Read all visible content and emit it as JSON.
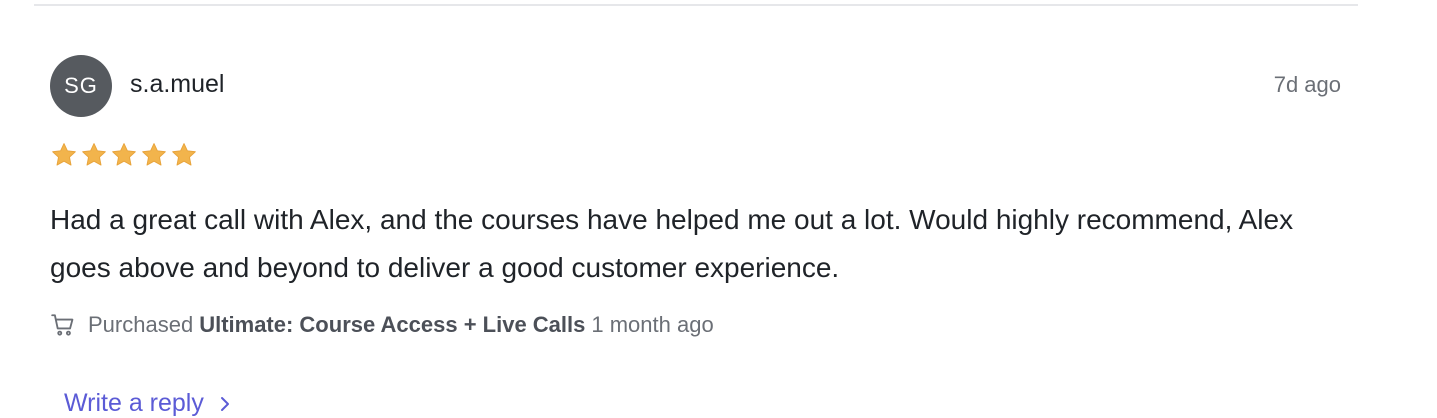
{
  "review": {
    "avatar_initials": "SG",
    "username": "s.a.muel",
    "time_ago": "7d ago",
    "rating": 5,
    "max_rating": 5,
    "star_color": "#f2b44c",
    "text": "Had a great call with Alex, and the courses have helped me out a lot. Would highly recommend, Alex goes above and beyond to deliver a good customer experience.",
    "purchase": {
      "prefix": "Purchased",
      "product": "Ultimate: Course Access + Live Calls",
      "when": "1 month ago",
      "icon": "cart-icon"
    },
    "reply_label": "Write a reply",
    "reply_icon": "chevron-right-icon",
    "link_color": "#5b5bd6"
  }
}
